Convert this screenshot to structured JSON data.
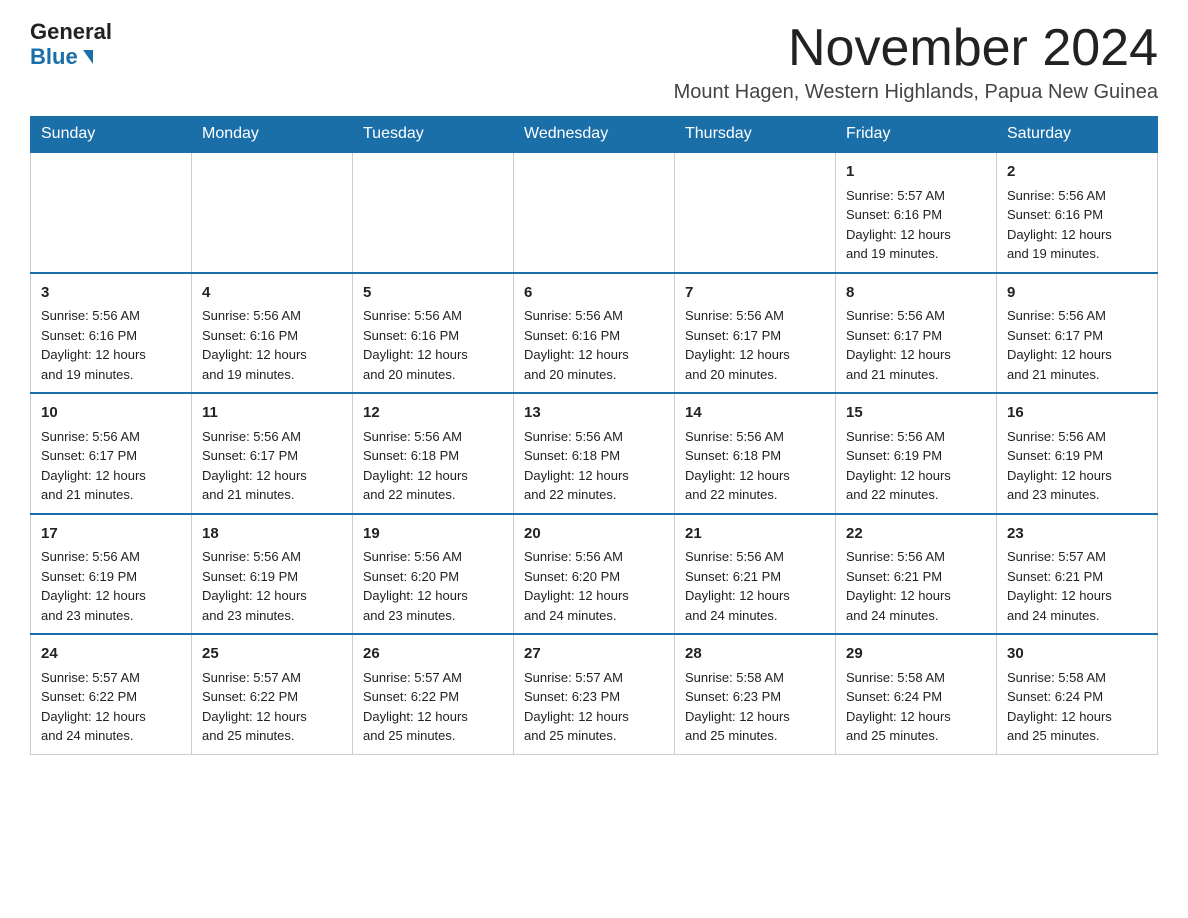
{
  "header": {
    "logo_general": "General",
    "logo_blue": "Blue",
    "month_title": "November 2024",
    "location": "Mount Hagen, Western Highlands, Papua New Guinea"
  },
  "weekdays": [
    "Sunday",
    "Monday",
    "Tuesday",
    "Wednesday",
    "Thursday",
    "Friday",
    "Saturday"
  ],
  "weeks": [
    [
      {
        "day": "",
        "info": ""
      },
      {
        "day": "",
        "info": ""
      },
      {
        "day": "",
        "info": ""
      },
      {
        "day": "",
        "info": ""
      },
      {
        "day": "",
        "info": ""
      },
      {
        "day": "1",
        "info": "Sunrise: 5:57 AM\nSunset: 6:16 PM\nDaylight: 12 hours\nand 19 minutes."
      },
      {
        "day": "2",
        "info": "Sunrise: 5:56 AM\nSunset: 6:16 PM\nDaylight: 12 hours\nand 19 minutes."
      }
    ],
    [
      {
        "day": "3",
        "info": "Sunrise: 5:56 AM\nSunset: 6:16 PM\nDaylight: 12 hours\nand 19 minutes."
      },
      {
        "day": "4",
        "info": "Sunrise: 5:56 AM\nSunset: 6:16 PM\nDaylight: 12 hours\nand 19 minutes."
      },
      {
        "day": "5",
        "info": "Sunrise: 5:56 AM\nSunset: 6:16 PM\nDaylight: 12 hours\nand 20 minutes."
      },
      {
        "day": "6",
        "info": "Sunrise: 5:56 AM\nSunset: 6:16 PM\nDaylight: 12 hours\nand 20 minutes."
      },
      {
        "day": "7",
        "info": "Sunrise: 5:56 AM\nSunset: 6:17 PM\nDaylight: 12 hours\nand 20 minutes."
      },
      {
        "day": "8",
        "info": "Sunrise: 5:56 AM\nSunset: 6:17 PM\nDaylight: 12 hours\nand 21 minutes."
      },
      {
        "day": "9",
        "info": "Sunrise: 5:56 AM\nSunset: 6:17 PM\nDaylight: 12 hours\nand 21 minutes."
      }
    ],
    [
      {
        "day": "10",
        "info": "Sunrise: 5:56 AM\nSunset: 6:17 PM\nDaylight: 12 hours\nand 21 minutes."
      },
      {
        "day": "11",
        "info": "Sunrise: 5:56 AM\nSunset: 6:17 PM\nDaylight: 12 hours\nand 21 minutes."
      },
      {
        "day": "12",
        "info": "Sunrise: 5:56 AM\nSunset: 6:18 PM\nDaylight: 12 hours\nand 22 minutes."
      },
      {
        "day": "13",
        "info": "Sunrise: 5:56 AM\nSunset: 6:18 PM\nDaylight: 12 hours\nand 22 minutes."
      },
      {
        "day": "14",
        "info": "Sunrise: 5:56 AM\nSunset: 6:18 PM\nDaylight: 12 hours\nand 22 minutes."
      },
      {
        "day": "15",
        "info": "Sunrise: 5:56 AM\nSunset: 6:19 PM\nDaylight: 12 hours\nand 22 minutes."
      },
      {
        "day": "16",
        "info": "Sunrise: 5:56 AM\nSunset: 6:19 PM\nDaylight: 12 hours\nand 23 minutes."
      }
    ],
    [
      {
        "day": "17",
        "info": "Sunrise: 5:56 AM\nSunset: 6:19 PM\nDaylight: 12 hours\nand 23 minutes."
      },
      {
        "day": "18",
        "info": "Sunrise: 5:56 AM\nSunset: 6:19 PM\nDaylight: 12 hours\nand 23 minutes."
      },
      {
        "day": "19",
        "info": "Sunrise: 5:56 AM\nSunset: 6:20 PM\nDaylight: 12 hours\nand 23 minutes."
      },
      {
        "day": "20",
        "info": "Sunrise: 5:56 AM\nSunset: 6:20 PM\nDaylight: 12 hours\nand 24 minutes."
      },
      {
        "day": "21",
        "info": "Sunrise: 5:56 AM\nSunset: 6:21 PM\nDaylight: 12 hours\nand 24 minutes."
      },
      {
        "day": "22",
        "info": "Sunrise: 5:56 AM\nSunset: 6:21 PM\nDaylight: 12 hours\nand 24 minutes."
      },
      {
        "day": "23",
        "info": "Sunrise: 5:57 AM\nSunset: 6:21 PM\nDaylight: 12 hours\nand 24 minutes."
      }
    ],
    [
      {
        "day": "24",
        "info": "Sunrise: 5:57 AM\nSunset: 6:22 PM\nDaylight: 12 hours\nand 24 minutes."
      },
      {
        "day": "25",
        "info": "Sunrise: 5:57 AM\nSunset: 6:22 PM\nDaylight: 12 hours\nand 25 minutes."
      },
      {
        "day": "26",
        "info": "Sunrise: 5:57 AM\nSunset: 6:22 PM\nDaylight: 12 hours\nand 25 minutes."
      },
      {
        "day": "27",
        "info": "Sunrise: 5:57 AM\nSunset: 6:23 PM\nDaylight: 12 hours\nand 25 minutes."
      },
      {
        "day": "28",
        "info": "Sunrise: 5:58 AM\nSunset: 6:23 PM\nDaylight: 12 hours\nand 25 minutes."
      },
      {
        "day": "29",
        "info": "Sunrise: 5:58 AM\nSunset: 6:24 PM\nDaylight: 12 hours\nand 25 minutes."
      },
      {
        "day": "30",
        "info": "Sunrise: 5:58 AM\nSunset: 6:24 PM\nDaylight: 12 hours\nand 25 minutes."
      }
    ]
  ]
}
